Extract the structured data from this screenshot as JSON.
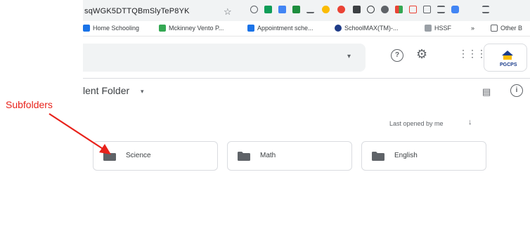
{
  "browser": {
    "url_fragment": "sqWGK5DTTQBmSlyTeP8YK",
    "bookmarks": [
      {
        "label": "Home Schooling",
        "color": "#1a73e8"
      },
      {
        "label": "Mckinney Vento P...",
        "color": "#34a853"
      },
      {
        "label": "Appointment sche...",
        "color": "#1a73e8"
      },
      {
        "label": "SchoolMAX(TM)-...",
        "color": "#1f3c88"
      },
      {
        "label": "HSSF",
        "color": "#9aa0a6"
      },
      {
        "label": "Other B",
        "color": "#5f6368"
      }
    ]
  },
  "drive": {
    "folder_title": "lent Folder",
    "sort_label": "Last opened by me",
    "org_logo_text": "PGCPS",
    "folders": [
      {
        "label": "Science"
      },
      {
        "label": "Math"
      },
      {
        "label": "English"
      }
    ]
  },
  "annotation": {
    "label": "Subfolders",
    "color": "#e8221b"
  }
}
